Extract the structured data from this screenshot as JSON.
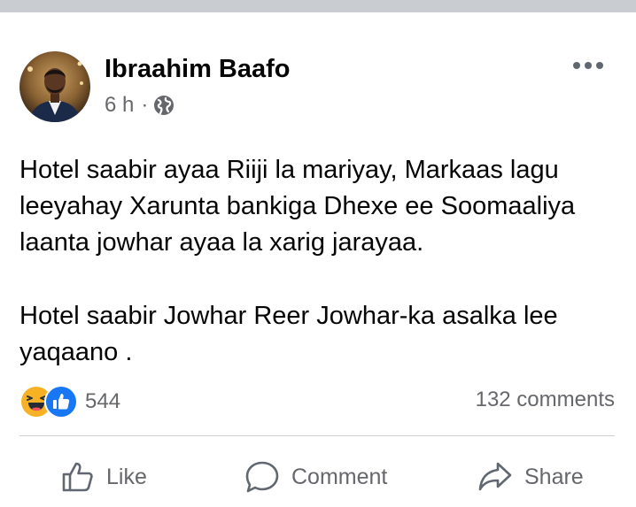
{
  "post": {
    "author": "Ibraahim Baafo",
    "time": "6 h",
    "separator": "·",
    "privacy_icon": "globe-icon",
    "more_icon": "more-options-icon",
    "paragraphs": [
      "Hotel saabir ayaa Riiji la mariyay, Markaas lagu leeyahay Xarunta bankiga Dhexe ee Soomaaliya laanta jowhar ayaa la xarig jarayaa.",
      "Hotel saabir Jowhar Reer Jowhar-ka asalka lee yaqaano ."
    ]
  },
  "stats": {
    "reaction_icons": [
      "haha-icon",
      "like-icon"
    ],
    "reaction_count": "544",
    "comments_count": "132 comments"
  },
  "actions": {
    "like_label": "Like",
    "comment_label": "Comment",
    "share_label": "Share"
  },
  "colors": {
    "text": "#050505",
    "secondary_text": "#65676b",
    "like_blue": "#1877f2",
    "haha_yellow": "#f7b125",
    "divider": "#ced0d4"
  }
}
